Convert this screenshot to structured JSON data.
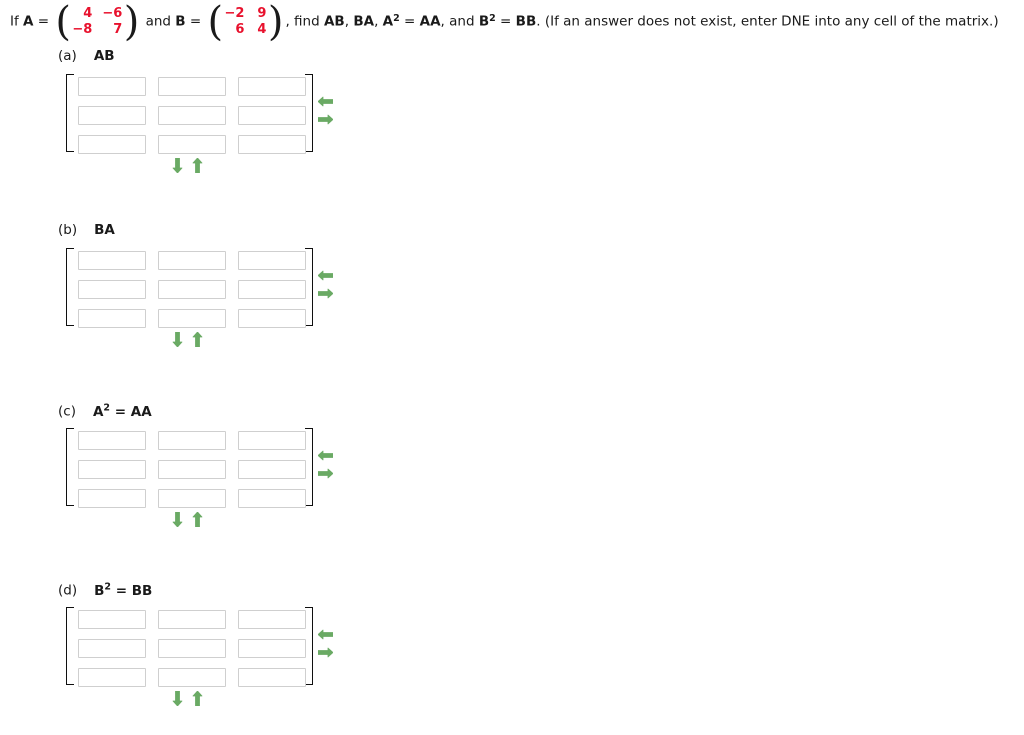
{
  "problem": {
    "lead": "If",
    "var_a": "A",
    "eq": "=",
    "matrix_a": {
      "rows": [
        [
          "4",
          "−6"
        ],
        [
          "−8",
          "7"
        ]
      ]
    },
    "conj": "and",
    "var_b": "B",
    "matrix_b": {
      "rows": [
        [
          "−2",
          "9"
        ],
        [
          "6",
          "4"
        ]
      ]
    },
    "find_text": ", find ",
    "t_ab": "AB",
    "sep1": ", ",
    "t_ba": "BA",
    "sep2": ", ",
    "t_a": "A",
    "sup2_a": "2",
    "eq2": " = ",
    "t_aa": "AA",
    "sep3": ", and ",
    "t_b": "B",
    "sup2_b": "2",
    "eq3": " = ",
    "t_bb": "BB",
    "note": ". (If an answer does not exist, enter DNE into any cell of the matrix.)"
  },
  "parts": [
    {
      "tag": "(a)",
      "expr": "AB",
      "expr_base": "AB",
      "expr_sup": "",
      "expr_tail": "",
      "matrix": {
        "rows": 3,
        "cols": 3,
        "values": [
          [
            "",
            "",
            ""
          ],
          [
            "",
            "",
            ""
          ],
          [
            "",
            "",
            ""
          ]
        ],
        "placeholder": ""
      }
    },
    {
      "tag": "(b)",
      "expr": "BA",
      "expr_base": "BA",
      "expr_sup": "",
      "expr_tail": "",
      "matrix": {
        "rows": 3,
        "cols": 3,
        "values": [
          [
            "",
            "",
            ""
          ],
          [
            "",
            "",
            ""
          ],
          [
            "",
            "",
            ""
          ]
        ],
        "placeholder": ""
      }
    },
    {
      "tag": "(c)",
      "expr": "A2 = AA",
      "expr_base": "A",
      "expr_sup": "2",
      "expr_tail": " = AA",
      "matrix": {
        "rows": 3,
        "cols": 3,
        "values": [
          [
            "",
            "",
            ""
          ],
          [
            "",
            "",
            ""
          ],
          [
            "",
            "",
            ""
          ]
        ],
        "placeholder": ""
      }
    },
    {
      "tag": "(d)",
      "expr": "B2 = BB",
      "expr_base": "B",
      "expr_sup": "2",
      "expr_tail": " = BB",
      "matrix": {
        "rows": 3,
        "cols": 3,
        "values": [
          [
            "",
            "",
            ""
          ],
          [
            "",
            "",
            ""
          ],
          [
            "",
            "",
            ""
          ]
        ],
        "placeholder": ""
      }
    }
  ],
  "controls": {
    "remove_column_icon": "arrow-left-icon",
    "add_column_icon": "arrow-right-icon",
    "add_row_icon": "arrow-down-icon",
    "remove_row_icon": "arrow-up-icon"
  },
  "colors": {
    "matrix_value": "#e8112d",
    "arrow_green": "#6aaa64",
    "input_border": "#cfcfcf",
    "text": "#1a1a1a"
  },
  "layout": {
    "part_tops": [
      48,
      222,
      402,
      581
    ]
  }
}
